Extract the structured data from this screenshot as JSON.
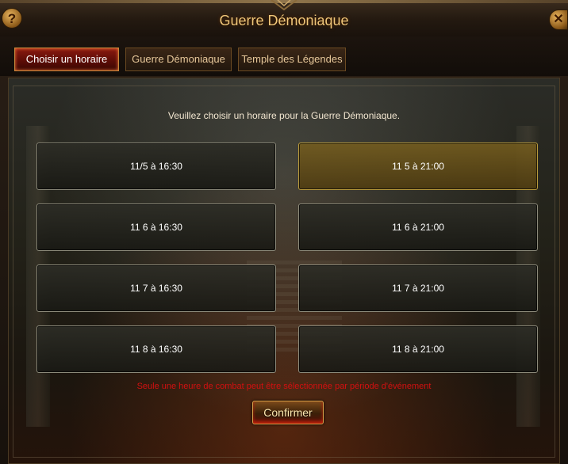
{
  "window": {
    "title": "Guerre Démoniaque",
    "help_label": "?",
    "close_label": "✕"
  },
  "tabs": [
    {
      "label": "Choisir un horaire",
      "active": true
    },
    {
      "label": "Guerre Démoniaque",
      "active": false
    },
    {
      "label": "Temple des Légendes",
      "active": false
    }
  ],
  "instruction": "Veuillez choisir un horaire pour la Guerre Démoniaque.",
  "slots": [
    {
      "label": "11/5 à 16:30",
      "selected": false
    },
    {
      "label": "11 5 à 21:00",
      "selected": true
    },
    {
      "label": "11 6 à 16:30",
      "selected": false
    },
    {
      "label": "11 6 à 21:00",
      "selected": false
    },
    {
      "label": "11 7 à 16:30",
      "selected": false
    },
    {
      "label": "11 7 à 21:00",
      "selected": false
    },
    {
      "label": "11 8 à 16:30",
      "selected": false
    },
    {
      "label": "11 8 à 21:00",
      "selected": false
    }
  ],
  "warning": "Seule une heure de combat peut être sélectionnée par période d'événement",
  "confirm_label": "Confirmer",
  "colors": {
    "title": "#f0c77a",
    "active_tab": "#8a1a10",
    "selected_slot": "#b89a3c",
    "warning": "#d21010"
  },
  "icons": {
    "help": "help-icon",
    "close": "close-icon",
    "crest": "crest-icon"
  }
}
